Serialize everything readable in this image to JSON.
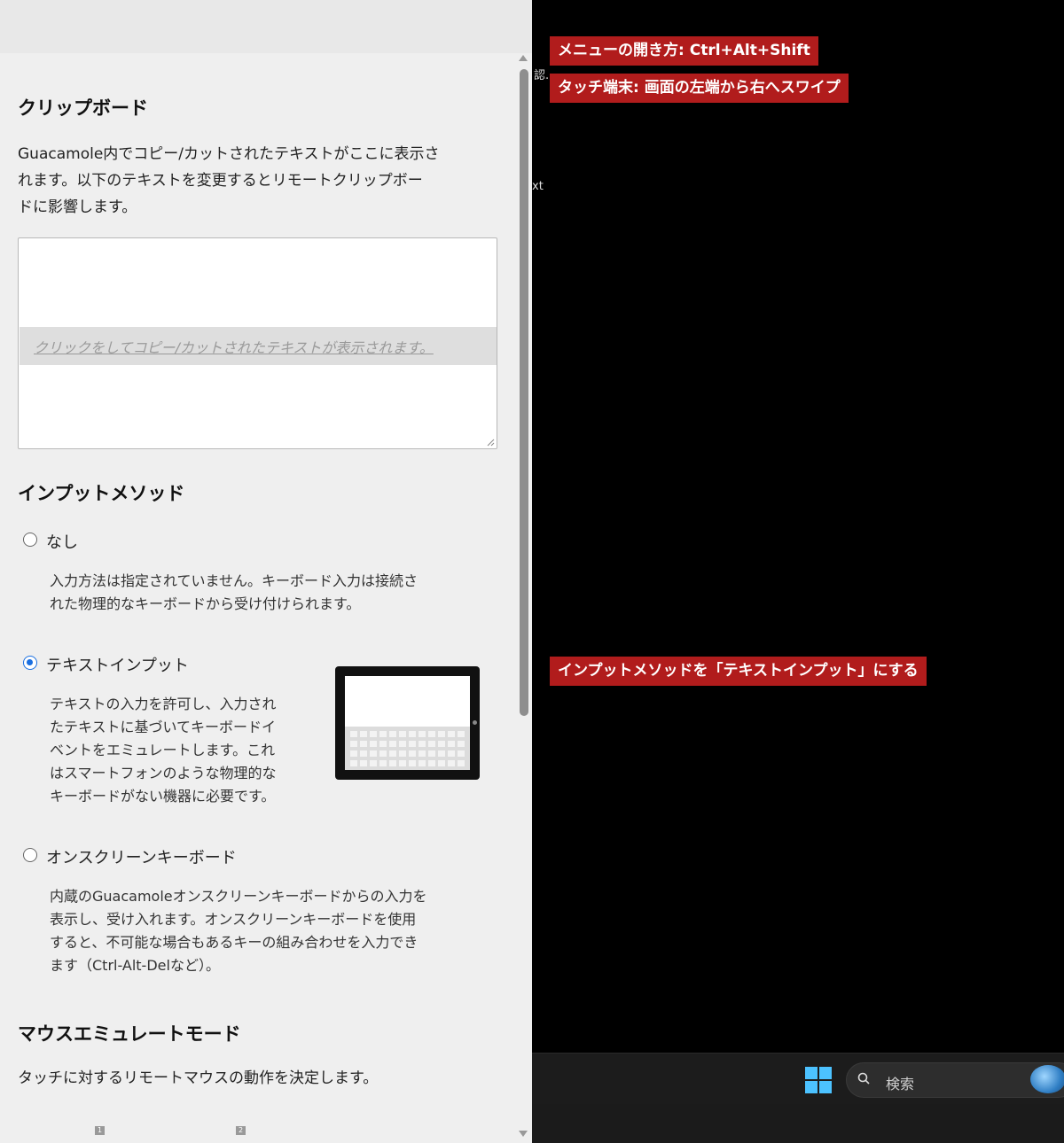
{
  "clipboard": {
    "title": "クリップボード",
    "desc_lines": [
      "Guacamole内でコピー/カットされたテキストがここに表示さ",
      "れます。以下のテキストを変更するとリモートクリップボー",
      "ドに影響します。"
    ],
    "hint": "クリックをしてコピー/カットされたテキストが表示されます。"
  },
  "input_method": {
    "title": "インプットメソッド",
    "options": [
      {
        "label": "なし",
        "checked": false,
        "desc_lines": [
          "入力方法は指定されていません。キーボード入力は接続さ",
          "れた物理的なキーボードから受け付けられます。"
        ]
      },
      {
        "label": "テキストインプット",
        "checked": true,
        "desc_lines": [
          "テキストの入力を許可し、入力され",
          "たテキストに基づいてキーボードイ",
          "ベントをエミュレートします。これ",
          "はスマートフォンのような物理的な",
          "キーボードがない機器に必要です。"
        ]
      },
      {
        "label": "オンスクリーンキーボード",
        "checked": false,
        "desc_lines": [
          "内蔵のGuacamoleオンスクリーンキーボードからの入力を",
          "表示し、受け入れます。オンスクリーンキーボードを使用",
          "すると、不可能な場合もあるキーの組み合わせを入力でき",
          "ます（Ctrl-Alt-Delなど）。"
        ]
      }
    ]
  },
  "mouse": {
    "title": "マウスエミュレートモード",
    "desc": "タッチに対するリモートマウスの動作を決定します。",
    "icon_labels": [
      "1",
      "2"
    ]
  },
  "remote": {
    "stray_1": "認.",
    "stray_2": "xt",
    "callouts": [
      "メニューの開き方: Ctrl+Alt+Shift",
      "タッチ端末: 画面の左端から右へスワイプ",
      "インプットメソッドを「テキストインプット」にする"
    ],
    "taskbar_search_placeholder": "検索"
  },
  "colors": {
    "callout": "#b11c1c",
    "radio_checked": "#1a6fe0",
    "windows_blue": "#4cc2ff"
  }
}
